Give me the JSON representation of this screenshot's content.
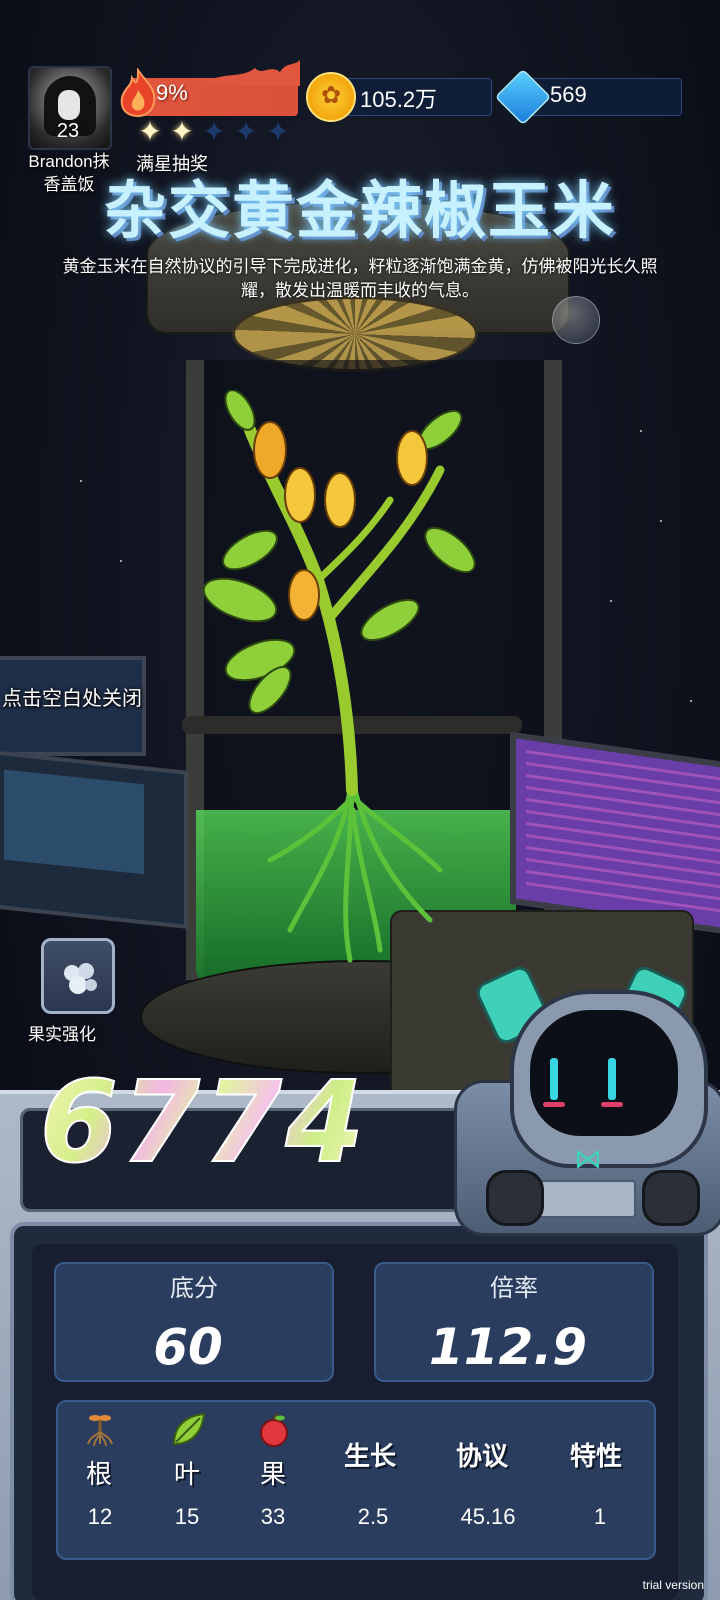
{
  "player": {
    "level": "23",
    "name": "Brandon抹\n香盖饭"
  },
  "star_progress": {
    "percent": "9%",
    "stars_total": 5,
    "stars_filled": 2,
    "label": "满星抽奖"
  },
  "currency": {
    "gold": "105.2万",
    "gems": "569"
  },
  "plant": {
    "title": "杂交黄金辣椒玉米",
    "description": "黄金玉米在自然协议的引导下完成进化，籽粒逐渐饱满金黄，仿佛被阳光长久照耀，散发出温暖而丰收的气息。"
  },
  "close_hint": "点击空白处关闭",
  "fruit_boost": {
    "label": "果实强化"
  },
  "score": {
    "total": "6774",
    "base_label": "底分",
    "base_value": "60",
    "mult_label": "倍率",
    "mult_value": "112.9"
  },
  "attributes": [
    {
      "label": "根",
      "value": "12",
      "icon": "root-icon"
    },
    {
      "label": "叶",
      "value": "15",
      "icon": "leaf-icon"
    },
    {
      "label": "果",
      "value": "33",
      "icon": "apple-icon"
    },
    {
      "label": "生长",
      "value": "2.5"
    },
    {
      "label": "协议",
      "value": "45.16"
    },
    {
      "label": "特性",
      "value": "1"
    }
  ],
  "watermark": "trial version",
  "colors": {
    "fire_bar": "#e0563e",
    "title_glow": "#7fd1ff",
    "panel_blue": "#2a3d5e",
    "robot_teal": "#3fd1b8"
  }
}
